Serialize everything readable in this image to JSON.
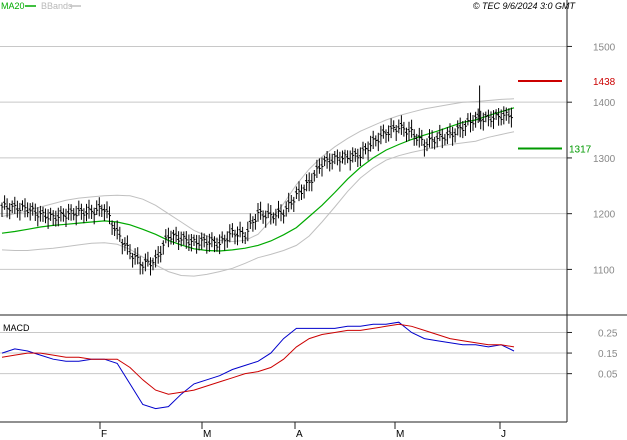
{
  "legend": {
    "ma_label": "MA20",
    "bb_label": "BBands",
    "ma_color": "#00aa00",
    "bb_color": "#c0c0c0"
  },
  "watermark": "© TEC 9/6/2024 3:0 GMT",
  "chart_data": [
    {
      "type": "line",
      "title": "",
      "price_type": "ohlc-bars",
      "x_tick_labels": [
        "F",
        "M",
        "A",
        "M",
        "J"
      ],
      "y_ticks": [
        1100,
        1200,
        1300,
        1400,
        1500
      ],
      "ylim": [
        1020,
        1560
      ],
      "grid": true,
      "levels": [
        {
          "label": "1438",
          "value": 1438,
          "color": "#cc0000"
        },
        {
          "label": "1317",
          "value": 1317,
          "color": "#009900"
        }
      ],
      "series": [
        {
          "name": "MA20",
          "color": "#00aa00",
          "values": [
            1165,
            1168,
            1172,
            1176,
            1179,
            1181,
            1183,
            1185,
            1187,
            1185,
            1180,
            1172,
            1163,
            1152,
            1144,
            1137,
            1134,
            1133,
            1135,
            1138,
            1143,
            1151,
            1162,
            1175,
            1195,
            1215,
            1238,
            1262,
            1283,
            1300,
            1314,
            1324,
            1333,
            1341,
            1348,
            1356,
            1364,
            1368,
            1376,
            1383,
            1390
          ]
        },
        {
          "name": "BBands upper",
          "color": "#c0c0c0",
          "values": [
            1195,
            1200,
            1205,
            1212,
            1218,
            1224,
            1228,
            1230,
            1232,
            1233,
            1232,
            1226,
            1215,
            1200,
            1185,
            1170,
            1160,
            1152,
            1150,
            1152,
            1163,
            1188,
            1218,
            1252,
            1280,
            1302,
            1320,
            1335,
            1348,
            1358,
            1368,
            1376,
            1382,
            1388,
            1392,
            1396,
            1400,
            1401,
            1403,
            1405,
            1406
          ]
        },
        {
          "name": "BBands lower",
          "color": "#c0c0c0",
          "values": [
            1135,
            1134,
            1134,
            1136,
            1138,
            1141,
            1144,
            1147,
            1148,
            1145,
            1136,
            1122,
            1108,
            1096,
            1089,
            1088,
            1091,
            1096,
            1102,
            1111,
            1121,
            1127,
            1134,
            1143,
            1160,
            1185,
            1212,
            1240,
            1264,
            1282,
            1296,
            1304,
            1310,
            1315,
            1320,
            1324,
            1327,
            1330,
            1337,
            1342,
            1347
          ]
        },
        {
          "name": "Price (close)",
          "color": "#000000",
          "values": [
            1212,
            1210,
            1208,
            1198,
            1193,
            1198,
            1202,
            1203,
            1210,
            1165,
            1130,
            1108,
            1115,
            1160,
            1155,
            1148,
            1150,
            1145,
            1165,
            1162,
            1200,
            1195,
            1202,
            1232,
            1255,
            1290,
            1298,
            1300,
            1305,
            1328,
            1345,
            1355,
            1345,
            1325,
            1335,
            1340,
            1355,
            1370,
            1370,
            1375,
            1378
          ]
        }
      ]
    },
    {
      "type": "line",
      "title": "MACD",
      "y_tick_labels": [
        "0.25",
        "0.15",
        "0.05"
      ],
      "y_ticks": [
        0.25,
        0.15,
        0.05
      ],
      "ylim": [
        -0.18,
        0.33
      ],
      "series": [
        {
          "name": "MACD",
          "color": "#0000cc",
          "values": [
            0.15,
            0.17,
            0.16,
            0.14,
            0.12,
            0.11,
            0.11,
            0.12,
            0.12,
            0.1,
            0.0,
            -0.1,
            -0.12,
            -0.11,
            -0.05,
            0.0,
            0.02,
            0.04,
            0.07,
            0.09,
            0.11,
            0.15,
            0.22,
            0.27,
            0.27,
            0.27,
            0.27,
            0.28,
            0.28,
            0.29,
            0.29,
            0.3,
            0.25,
            0.22,
            0.21,
            0.2,
            0.19,
            0.19,
            0.18,
            0.19,
            0.16
          ]
        },
        {
          "name": "Signal",
          "color": "#cc0000",
          "values": [
            0.13,
            0.14,
            0.15,
            0.15,
            0.14,
            0.13,
            0.13,
            0.12,
            0.12,
            0.12,
            0.08,
            0.02,
            -0.03,
            -0.05,
            -0.04,
            -0.03,
            -0.01,
            0.01,
            0.03,
            0.05,
            0.06,
            0.08,
            0.12,
            0.18,
            0.22,
            0.24,
            0.25,
            0.26,
            0.26,
            0.27,
            0.28,
            0.29,
            0.28,
            0.26,
            0.24,
            0.22,
            0.21,
            0.2,
            0.19,
            0.19,
            0.18
          ]
        }
      ]
    }
  ]
}
